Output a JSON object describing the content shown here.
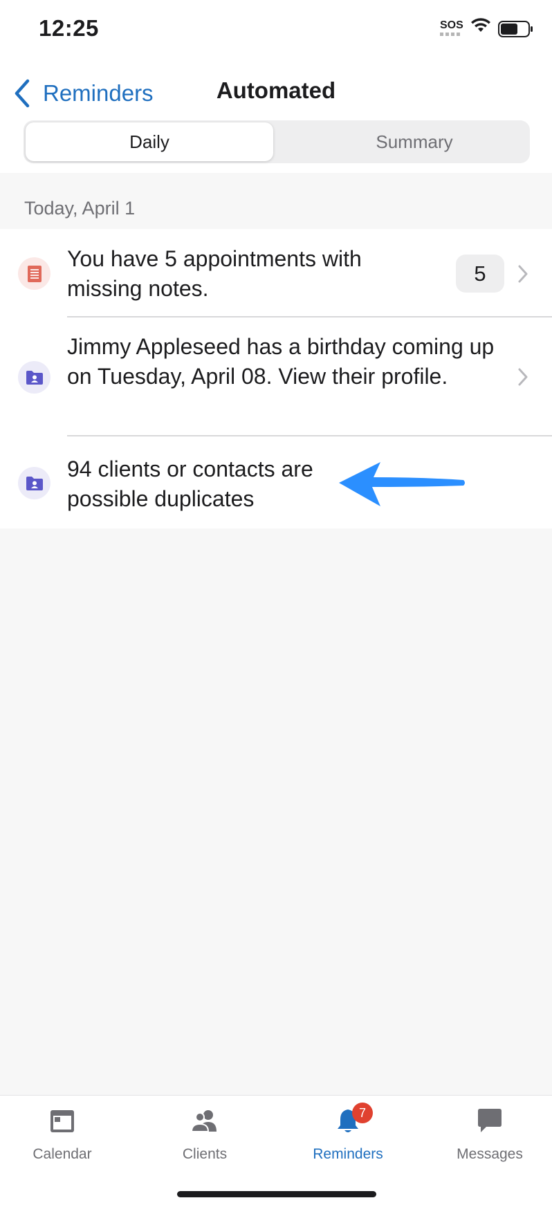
{
  "status_bar": {
    "time": "12:25",
    "sos": "SOS",
    "icons": [
      "wifi-icon",
      "battery-icon"
    ]
  },
  "nav": {
    "back_label": "Reminders",
    "title": "Automated",
    "back_icon": "chevron-left-icon"
  },
  "segmented": {
    "options": [
      "Daily",
      "Summary"
    ],
    "selected": "Daily"
  },
  "section": {
    "header": "Today, April 1"
  },
  "reminders": [
    {
      "icon": "notes-icon",
      "text": "You have 5 appointments with missing notes.",
      "count": "5",
      "has_chevron": true
    },
    {
      "icon": "client-folder-icon",
      "text": "Jimmy Appleseed has a birthday coming up on Tuesday, April 08. View their profile.",
      "has_chevron": true
    },
    {
      "icon": "client-folder-icon",
      "text": "94 clients or contacts are possible duplicates",
      "has_chevron": false
    }
  ],
  "tab_bar": {
    "tabs": [
      {
        "label": "Calendar",
        "icon": "calendar-icon"
      },
      {
        "label": "Clients",
        "icon": "clients-icon"
      },
      {
        "label": "Reminders",
        "icon": "bell-icon",
        "badge": "7",
        "active": true
      },
      {
        "label": "Messages",
        "icon": "message-icon"
      }
    ]
  },
  "colors": {
    "accent": "#1f6fbf",
    "badge": "#e0412f",
    "notes_icon": "#e0695a",
    "client_icon": "#5b57c9",
    "annotation_arrow": "#2b8fff"
  }
}
